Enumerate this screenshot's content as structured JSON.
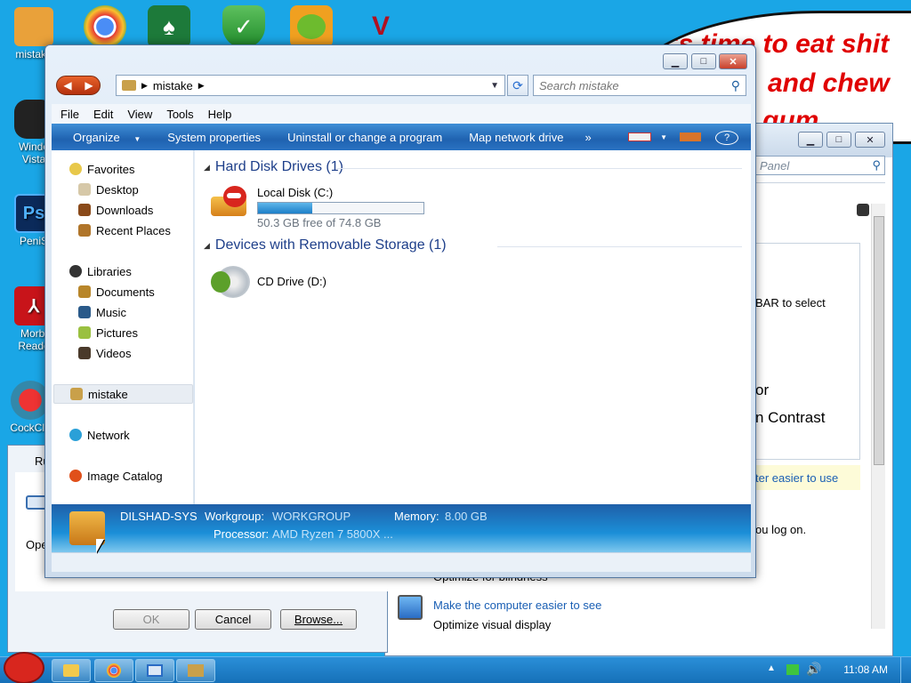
{
  "desktop": {
    "icons": [
      {
        "label": "mistake"
      },
      {
        "label": "Windo\nVista"
      },
      {
        "label": "PeniS"
      },
      {
        "label": "Morbi\nReade"
      },
      {
        "label": "CockCle"
      }
    ],
    "bubble_lines": [
      "it's time to eat shit",
      "and chew",
      "gum"
    ]
  },
  "explorer": {
    "address_path": "mistake",
    "search_placeholder": "Search mistake",
    "menu": [
      "File",
      "Edit",
      "View",
      "Tools",
      "Help"
    ],
    "commands": [
      "Organize",
      "System properties",
      "Uninstall or change a program",
      "Map network drive",
      "»"
    ],
    "nav": {
      "favorites": "Favorites",
      "desktop": "Desktop",
      "downloads": "Downloads",
      "recent": "Recent Places",
      "libraries": "Libraries",
      "documents": "Documents",
      "music": "Music",
      "pictures": "Pictures",
      "videos": "Videos",
      "computer": "mistake",
      "network": "Network",
      "image_catalog": "Image Catalog"
    },
    "groups": {
      "hdd": "Hard Disk Drives (1)",
      "removable": "Devices with Removable Storage (1)"
    },
    "drives": {
      "c_name": "Local Disk (C:)",
      "c_free": "50.3 GB free of 74.8 GB",
      "c_used_fraction": 0.328,
      "d_name": "CD Drive (D:)"
    },
    "details": {
      "computer_name": "DILSHAD-SYS",
      "workgroup_label": "Workgroup:",
      "workgroup_value": "WORKGROUP",
      "memory_label": "Memory:",
      "memory_value": "8.00 GB",
      "processor_label": "Processor:",
      "processor_value": "AMD Ryzen 7 5800X ..."
    }
  },
  "control_panel": {
    "search_placeholder": "Panel",
    "text_select": "BAR to select",
    "text_or": "or",
    "text_contrast": "n Contrast",
    "link_easier": "ter easier to use",
    "text_logon": "ou log on.",
    "text_blindness": "Optimize for blindness",
    "link_see": "Make the computer easier to see",
    "text_visual": "Optimize visual display"
  },
  "run_dialog": {
    "title": "Ru",
    "open_label": "Ope",
    "ok": "OK",
    "cancel": "Cancel",
    "browse": "Browse..."
  },
  "taskbar": {
    "time": "11:08 AM"
  },
  "colors": {
    "desktop_bg": "#1aa6e6",
    "group_header": "#1e3f8a",
    "bubble_text": "#e00000",
    "link": "#1a5fb4"
  }
}
